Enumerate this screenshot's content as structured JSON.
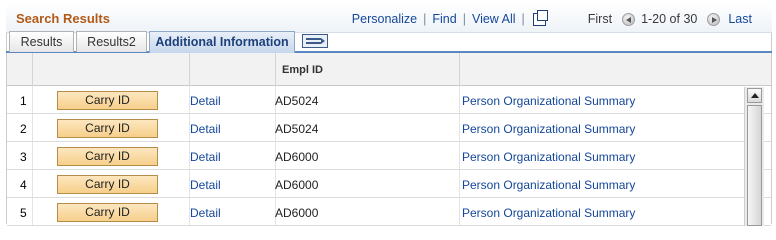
{
  "header": {
    "title": "Search Results",
    "nav": {
      "personalize": "Personalize",
      "find": "Find",
      "view_all": "View All",
      "first": "First",
      "range": "1-20 of 30",
      "last": "Last"
    }
  },
  "tabs": [
    {
      "label": "Results",
      "active": false
    },
    {
      "label": "Results2",
      "active": false
    },
    {
      "label": "Additional Information",
      "active": true
    }
  ],
  "table": {
    "columns": [
      "",
      "",
      "",
      "Empl ID",
      ""
    ],
    "rows": [
      {
        "num": "1",
        "button": "Carry ID",
        "detail": "Detail",
        "empl_id": "AD5024",
        "link": "Person Organizational Summary"
      },
      {
        "num": "2",
        "button": "Carry ID",
        "detail": "Detail",
        "empl_id": "AD5024",
        "link": "Person Organizational Summary"
      },
      {
        "num": "3",
        "button": "Carry ID",
        "detail": "Detail",
        "empl_id": "AD6000",
        "link": "Person Organizational Summary"
      },
      {
        "num": "4",
        "button": "Carry ID",
        "detail": "Detail",
        "empl_id": "AD6000",
        "link": "Person Organizational Summary"
      },
      {
        "num": "5",
        "button": "Carry ID",
        "detail": "Detail",
        "empl_id": "AD6000",
        "link": "Person Organizational Summary"
      }
    ]
  },
  "colors": {
    "title": "#b35a19",
    "link": "#14479a",
    "button_fill": "#f6cf8a",
    "tab_active_border": "#5b87c2"
  },
  "icons": {
    "zoom": "zoom-new-window-icon",
    "first": "arrow-left-icon",
    "last": "arrow-right-icon",
    "show_all_tabs": "show-all-columns-icon",
    "scroll_up": "scroll-up-arrow-icon"
  }
}
